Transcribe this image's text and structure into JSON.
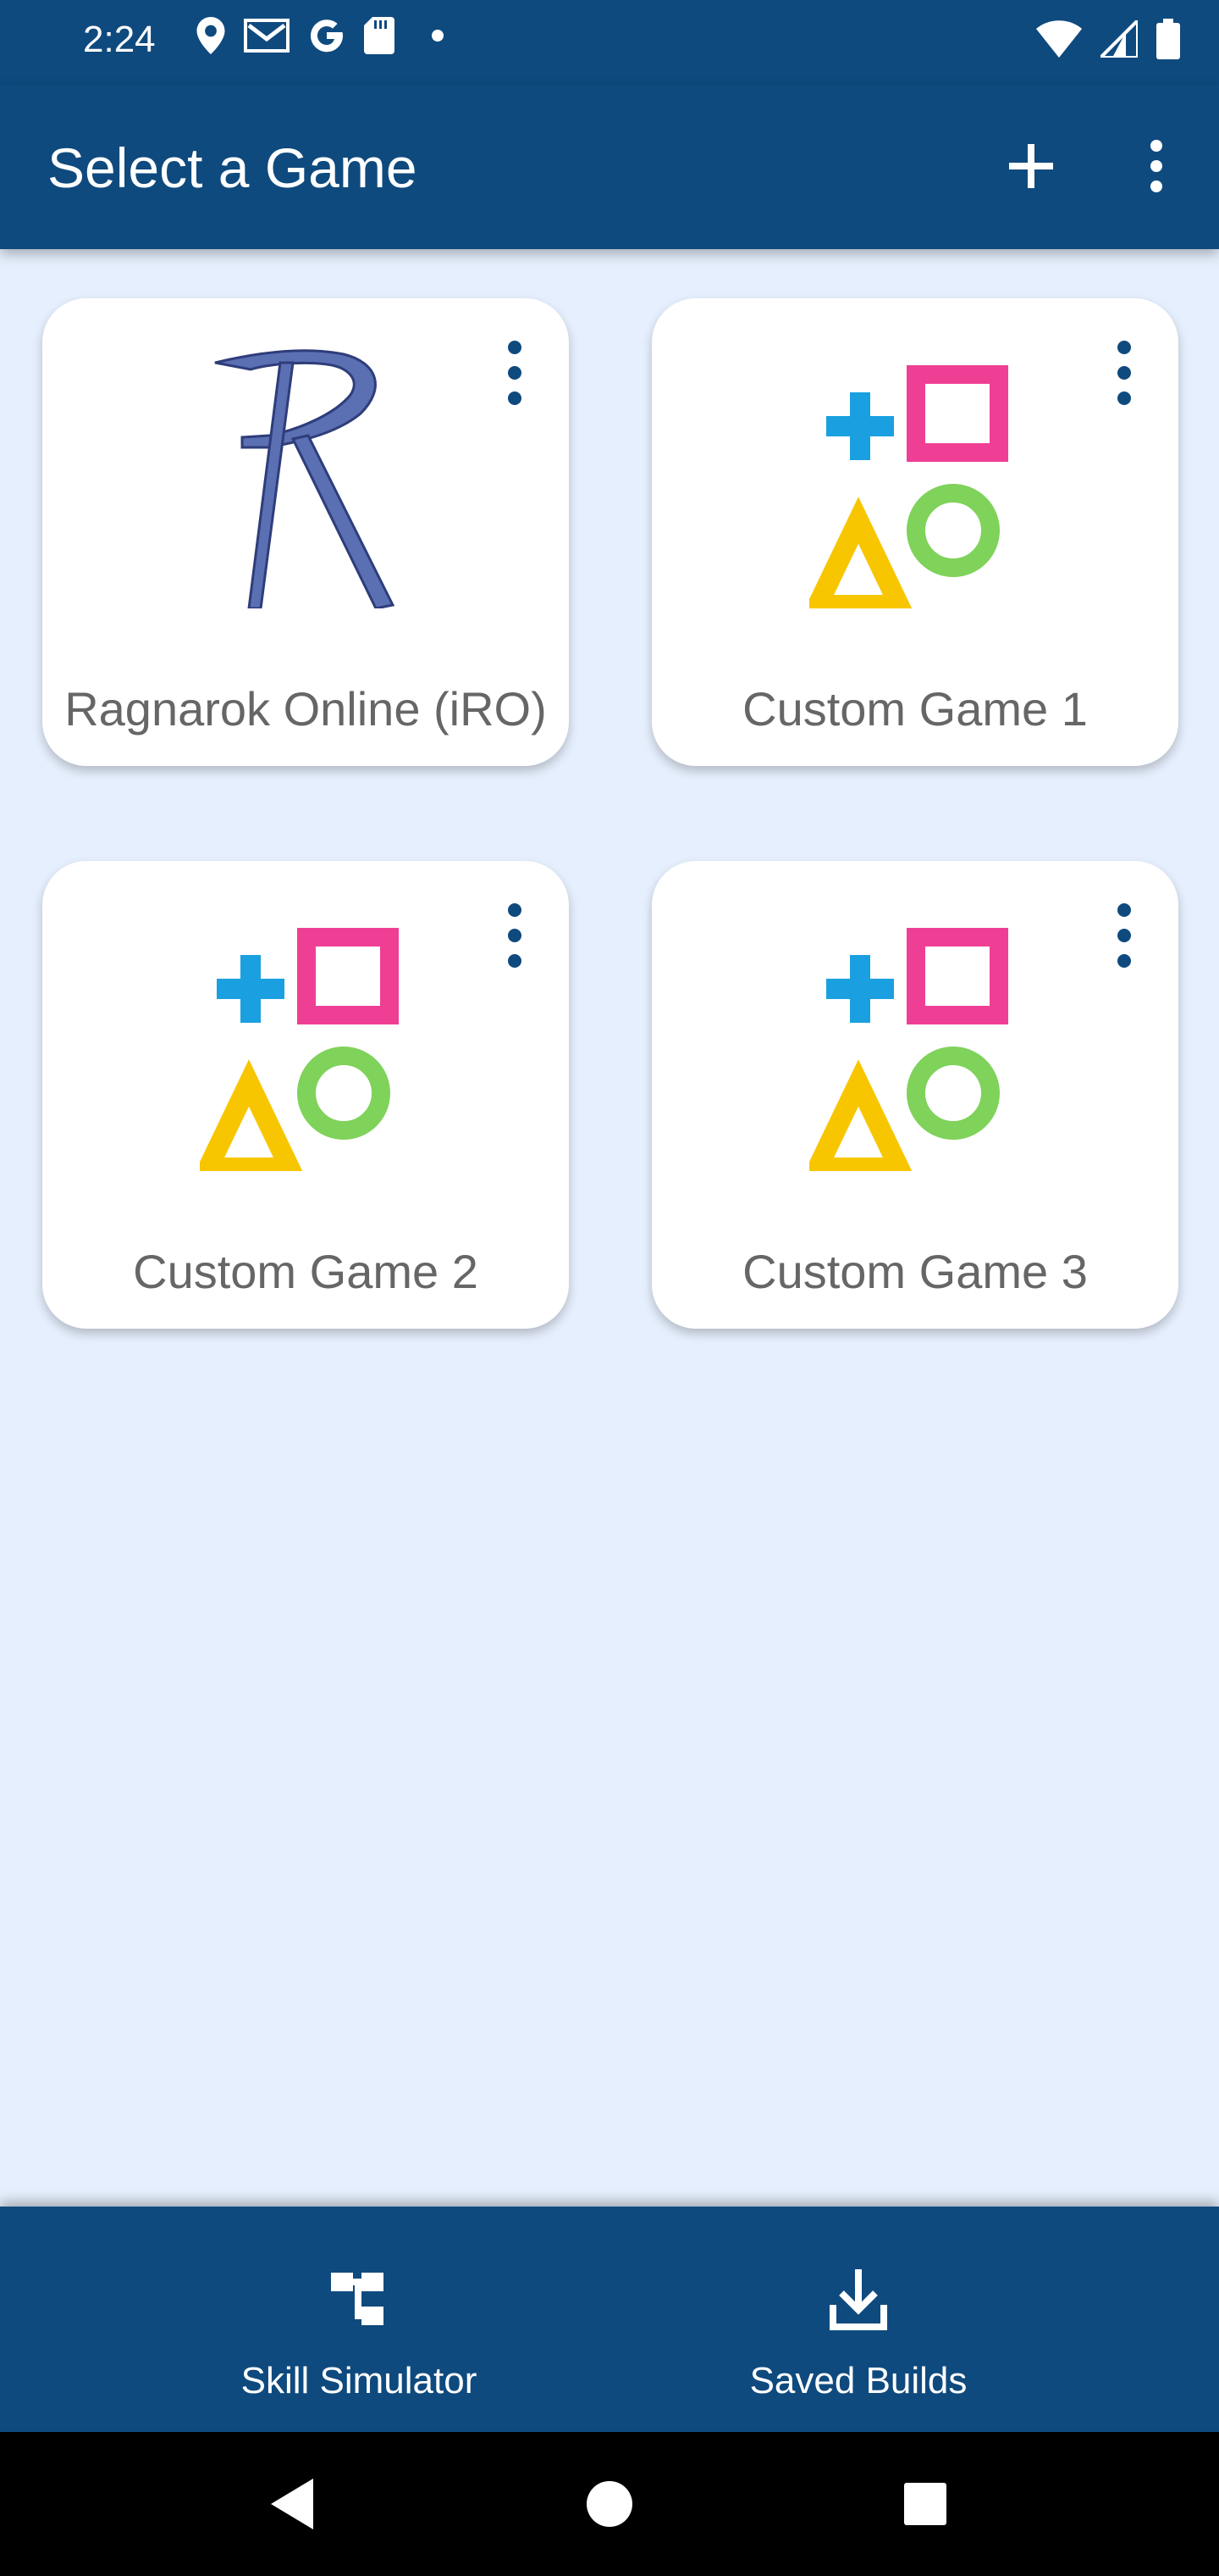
{
  "status_bar": {
    "time": "2:24",
    "left_icons": [
      "location-icon",
      "gmail-icon",
      "google-icon",
      "sd-card-icon",
      "dot-icon"
    ],
    "right_icons": [
      "wifi-icon",
      "signal-icon",
      "battery-icon"
    ]
  },
  "app_bar": {
    "title": "Select a Game",
    "actions": [
      "plus-icon",
      "more-vertical-icon"
    ]
  },
  "games": [
    {
      "label": "Ragnarok Online (iRO)",
      "icon": "ragnarok-logo"
    },
    {
      "label": "Custom Game 1",
      "icon": "shapes-logo"
    },
    {
      "label": "Custom Game 2",
      "icon": "shapes-logo"
    },
    {
      "label": "Custom Game 3",
      "icon": "shapes-logo"
    }
  ],
  "bottom_nav": {
    "skill_simulator": "Skill Simulator",
    "saved_builds": "Saved Builds"
  },
  "colors": {
    "primary": "#0f4a7e",
    "background": "#e6effd",
    "card": "#ffffff",
    "plus_blue": "#1aa0e0",
    "square_pink": "#ef3f95",
    "circle_green": "#7fd25a",
    "triangle_yellow": "#f7c600",
    "ragnarok_blue": "#5b6fb3"
  }
}
